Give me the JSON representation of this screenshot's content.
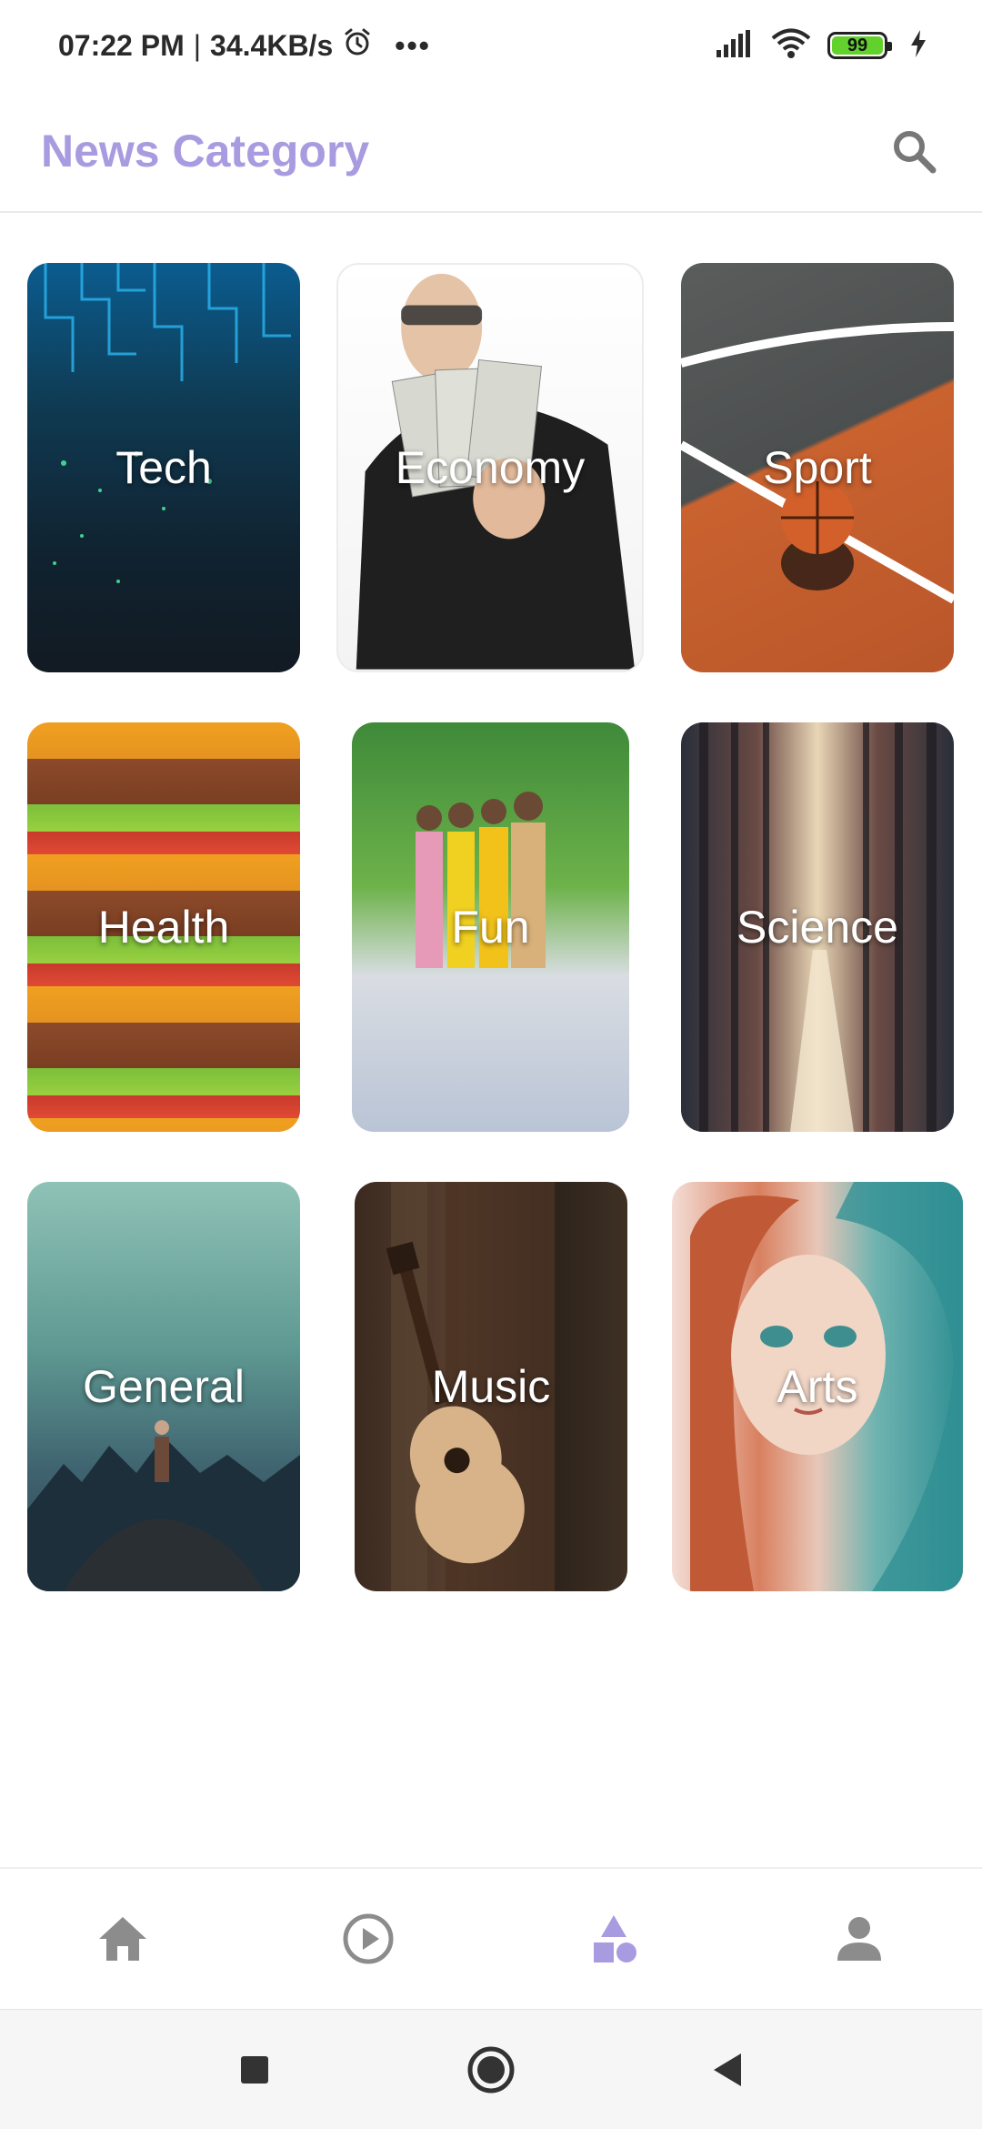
{
  "status_bar": {
    "time": "07:22 PM",
    "separator": "|",
    "net_speed": "34.4KB/s",
    "more_indicator": "•••",
    "battery_level": "99",
    "icons": [
      "alarm-icon",
      "signal-icon",
      "wifi-icon",
      "battery-icon",
      "charging-icon"
    ]
  },
  "app_bar": {
    "title": "News Category",
    "search_icon": "search-icon",
    "title_color": "#a99be0"
  },
  "categories": [
    {
      "label": "Tech"
    },
    {
      "label": "Economy"
    },
    {
      "label": "Sport"
    },
    {
      "label": "Health"
    },
    {
      "label": "Fun"
    },
    {
      "label": "Science"
    },
    {
      "label": "General"
    },
    {
      "label": "Music"
    },
    {
      "label": "Arts"
    }
  ],
  "bottom_nav": {
    "items": [
      {
        "icon": "home-icon",
        "active": false
      },
      {
        "icon": "play-circle-icon",
        "active": false
      },
      {
        "icon": "category-shapes-icon",
        "active": true
      },
      {
        "icon": "person-icon",
        "active": false
      }
    ],
    "active_color": "#a99be0",
    "inactive_color": "#8c8c8c"
  },
  "system_nav": {
    "buttons": [
      "recent-apps-icon",
      "home-circle-icon",
      "back-triangle-icon"
    ]
  }
}
